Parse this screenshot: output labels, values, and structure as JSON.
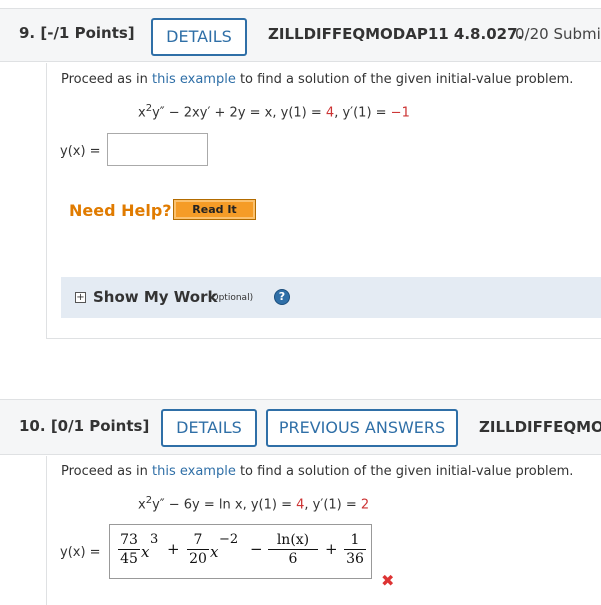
{
  "q9": {
    "number": "9.",
    "points": "[-/1 Points]",
    "details_label": "DETAILS",
    "code": "ZILLDIFFEQMODAP11 4.8.027.",
    "score": "0/20 Submi",
    "prompt_before": "Proceed as in ",
    "prompt_link": "this example",
    "prompt_after": " to find a solution of the given initial-value problem.",
    "eq_lhs": "x",
    "eq_exp": "2",
    "eq_mid": "y″ − 2xy′ + 2y = x, y(1) = ",
    "eq_val1": "4",
    "eq_mid2": ", y′(1) = ",
    "eq_val2": "−1",
    "answer_label": "y(x) =",
    "answer_value": "",
    "need_help": "Need Help?",
    "read_it": "Read It",
    "show_work": "Show My Work",
    "optional": "(Optional)",
    "help_glyph": "?",
    "plus_glyph": "+"
  },
  "q10": {
    "number": "10.",
    "points": "[0/1 Points]",
    "details_label": "DETAILS",
    "prev_answers_label": "PREVIOUS ANSWERS",
    "code": "ZILLDIFFEQMOD",
    "prompt_before": "Proceed as in ",
    "prompt_link": "this example",
    "prompt_after": " to find a solution of the given initial-value problem.",
    "eq_lhs": "x",
    "eq_exp": "2",
    "eq_mid": "y″ − 6y = ln x, y(1) = ",
    "eq_val1": "4",
    "eq_mid2": ", y′(1) = ",
    "eq_val2": "2",
    "answer_label": "y(x) =",
    "answer": {
      "t1_num": "73",
      "t1_den": "45",
      "t1_var": "x",
      "t1_exp": "3",
      "op1": "+",
      "t2_num": "7",
      "t2_den": "20",
      "t2_var": "x",
      "t2_exp": "−2",
      "op2": "−",
      "t3_num": "ln(x)",
      "t3_den": "6",
      "op3": "+",
      "t4_num": "1",
      "t4_den": "36"
    },
    "status_icon": "incorrect-x-icon",
    "status_glyph": "✖",
    "status_color": "#d33333"
  },
  "colors": {
    "accent": "#2f6fa7",
    "help_orange": "#e07b00",
    "value_red": "#cc3333"
  }
}
